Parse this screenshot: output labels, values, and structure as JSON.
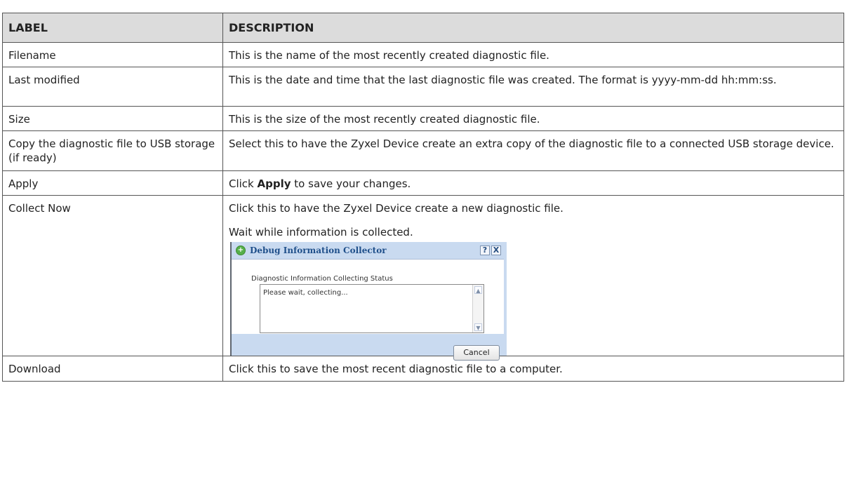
{
  "table": {
    "headers": {
      "label": "LABEL",
      "description": "DESCRIPTION"
    },
    "rows": [
      {
        "label": "Filename",
        "description": "This is the name of the most recently created diagnostic file."
      },
      {
        "label": "Last modified",
        "description": "This is the date and time that the last diagnostic file was created. The format is yyyy-mm-dd hh:mm:ss."
      },
      {
        "label": "Size",
        "description": "This is the size of the most recently created diagnostic file."
      },
      {
        "label": "Copy the diagnostic file to USB storage (if ready)",
        "description": "Select this to have the Zyxel Device create an extra copy of the diagnostic file to a connected USB storage device."
      },
      {
        "label": "Apply",
        "description_prefix": "Click ",
        "description_bold": "Apply",
        "description_suffix": " to save your changes."
      },
      {
        "label": "Collect Now",
        "description": "Click this to have the Zyxel Device create a new diagnostic file.",
        "description_2": "Wait while information is collected."
      },
      {
        "label": "Download",
        "description": "Click this to save the most recent diagnostic file to a computer."
      }
    ]
  },
  "dialog": {
    "title": "Debug Information Collector",
    "help_icon": "?",
    "close_icon": "X",
    "status_label": "Diagnostic Information Collecting Status",
    "status_text": "Please wait, collecting...",
    "cancel_label": "Cancel"
  },
  "colors": {
    "header_bg": "#dcdcdc",
    "dialog_frame": "#c9daf0",
    "dialog_title": "#1f4f8a"
  }
}
